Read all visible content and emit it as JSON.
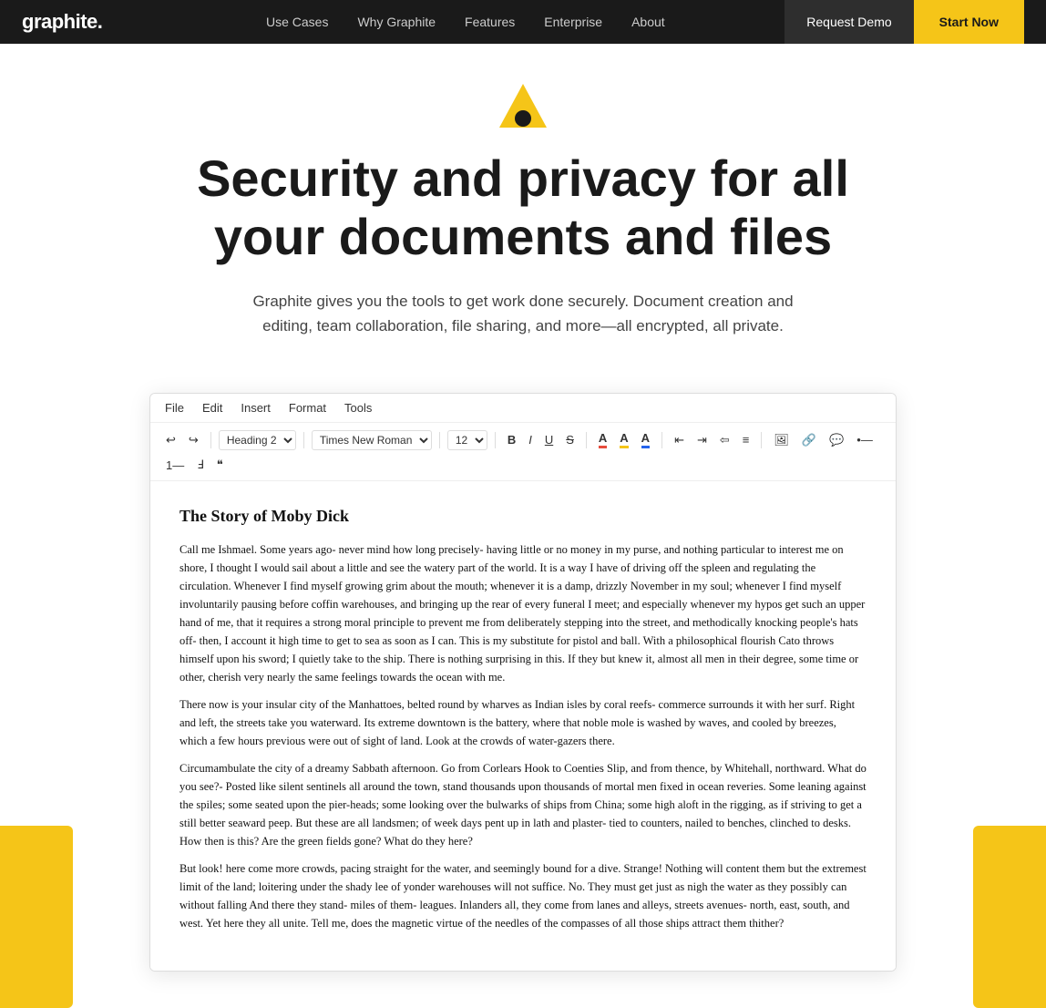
{
  "nav": {
    "logo": "graphite.",
    "links": [
      {
        "label": "Use Cases",
        "id": "use-cases"
      },
      {
        "label": "Why Graphite",
        "id": "why-graphite"
      },
      {
        "label": "Features",
        "id": "features"
      },
      {
        "label": "Enterprise",
        "id": "enterprise"
      },
      {
        "label": "About",
        "id": "about"
      }
    ],
    "request_demo": "Request Demo",
    "start_now": "Start Now"
  },
  "hero": {
    "title": "Security and privacy for all your documents and files",
    "subtitle": "Graphite gives you the tools to get work done securely. Document creation and editing, team collaboration, file sharing, and more—all encrypted, all private."
  },
  "editor": {
    "menu": [
      "File",
      "Edit",
      "Insert",
      "Format",
      "Tools"
    ],
    "toolbar": {
      "heading": "Heading 2",
      "font": "Times New Roman",
      "size": "12",
      "bold": "B",
      "italic": "I",
      "underline": "U",
      "strikethrough": "S"
    },
    "title": "The Story of Moby Dick",
    "paragraphs": [
      "Call me Ishmael. Some years ago- never mind how long precisely- having little or no money in my purse, and nothing particular to interest me on shore, I thought I would sail about a little and see the watery part of the world. It is a way I have of driving off the spleen and regulating the circulation. Whenever I find myself growing grim about the mouth; whenever it is a damp, drizzly November in my soul; whenever I find myself involuntarily pausing before coffin warehouses, and bringing up the rear of every funeral I meet; and especially whenever my hypos get such an upper hand of me, that it requires a strong moral principle to prevent me from deliberately stepping into the street, and methodically knocking people's hats off- then, I account it high time to get to sea as soon as I can. This is my substitute for pistol and ball. With a philosophical flourish Cato throws himself upon his sword; I quietly take to the ship. There is nothing surprising in this. If they but knew it, almost all men in their degree, some time or other, cherish very nearly the same feelings towards the ocean with me.",
      "There now is your insular city of the Manhattoes, belted round by wharves as Indian isles by coral reefs- commerce surrounds it with her surf. Right and left, the streets take you waterward. Its extreme downtown is the battery, where that noble mole is washed by waves, and cooled by breezes, which a few hours previous were out of sight of land. Look at the crowds of water-gazers there.",
      "Circumambulate the city of a dreamy Sabbath afternoon. Go from Corlears Hook to Coenties Slip, and from thence, by Whitehall, northward. What do you see?- Posted like silent sentinels all around the town, stand thousands upon thousands of mortal men fixed in ocean reveries. Some leaning against the spiles; some seated upon the pier-heads; some looking over the bulwarks of ships from China; some high aloft in the rigging, as if striving to get a still better seaward peep. But these are all landsmen; of week days pent up in lath and plaster- tied to counters, nailed to benches, clinched to desks. How then is this? Are the green fields gone? What do they here?",
      "But look! here come more crowds, pacing straight for the water, and seemingly bound for a dive. Strange! Nothing will content them but the extremest limit of the land; loitering under the shady lee of yonder warehouses will not suffice. No. They must get just as nigh the water as they possibly can without falling And there they stand- miles of them- leagues. Inlanders all, they come from lanes and alleys, streets avenues- north, east, south, and west. Yet here they all unite. Tell me, does the magnetic virtue of the needles of the compasses of all those ships attract them thither?"
    ]
  }
}
